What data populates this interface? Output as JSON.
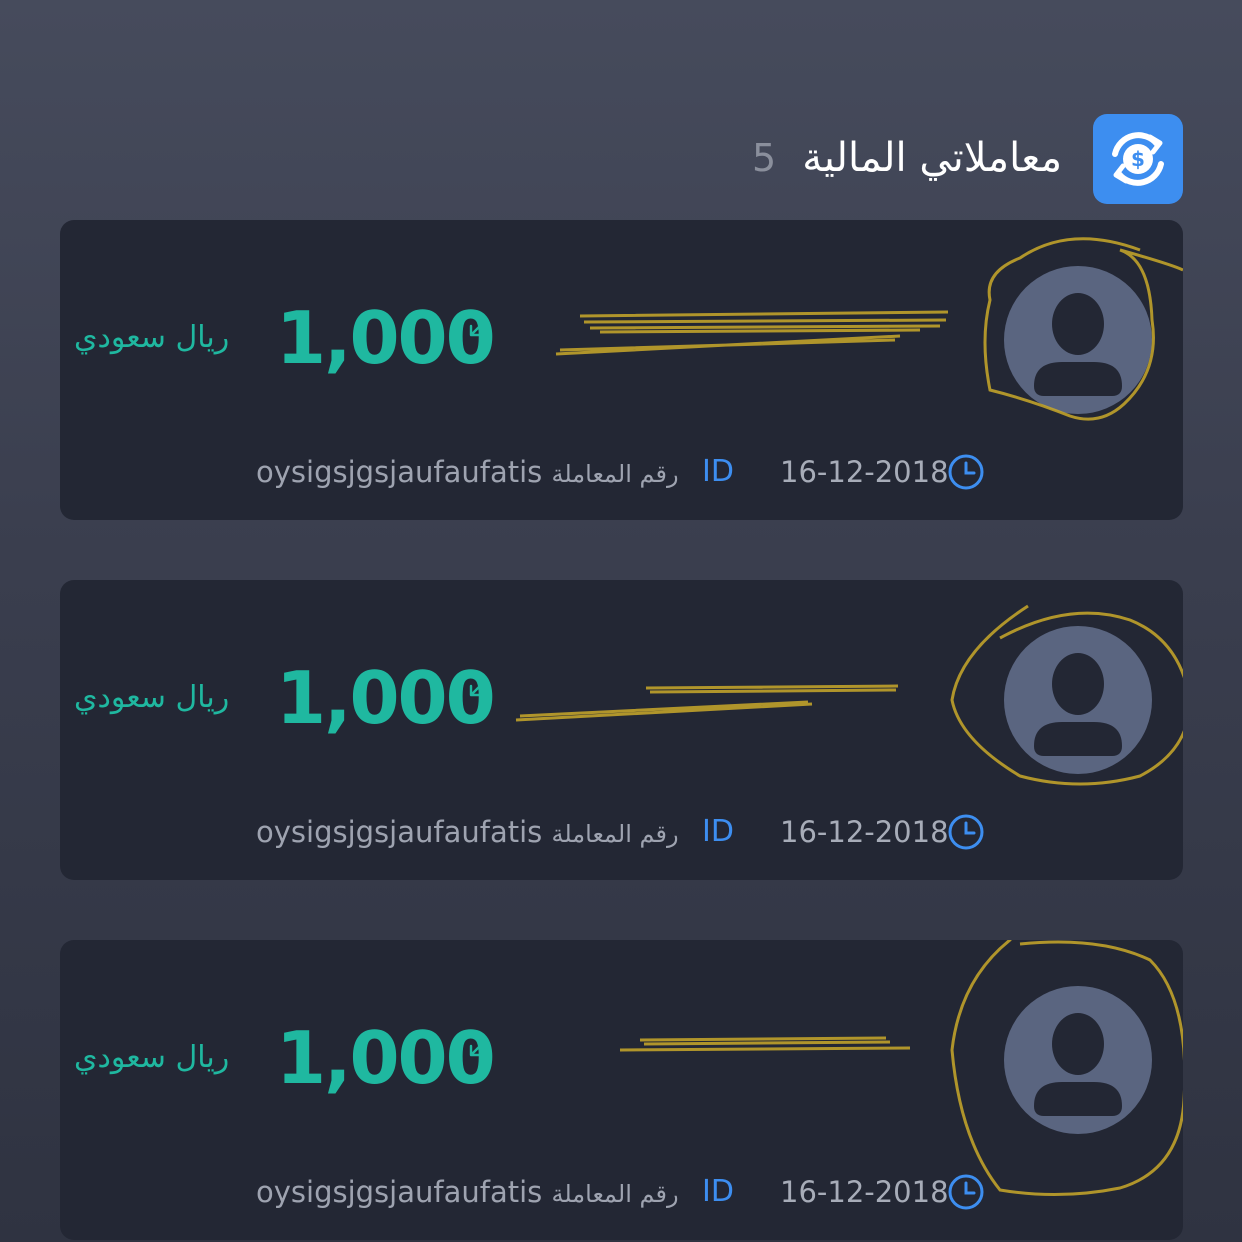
{
  "header": {
    "title": "معاملاتي المالية",
    "count": "5",
    "icon": "currency-exchange-icon",
    "accent": "#3d8ef0"
  },
  "transactions": [
    {
      "amount": "1,000",
      "currency": "ريال سعودي",
      "direction_icon": "arrow-incoming-icon",
      "avatar_icon": "user-placeholder-icon",
      "id_tag": "ID",
      "txn_id": "oysigsjgsjaufaufatis",
      "txn_label": "رقم المعاملة",
      "date": "16-12-2018",
      "clock_icon": "clock-icon"
    },
    {
      "amount": "1,000",
      "currency": "ريال سعودي",
      "direction_icon": "arrow-incoming-icon",
      "avatar_icon": "user-placeholder-icon",
      "id_tag": "ID",
      "txn_id": "oysigsjgsjaufaufatis",
      "txn_label": "رقم المعاملة",
      "date": "16-12-2018",
      "clock_icon": "clock-icon"
    },
    {
      "amount": "1,000",
      "currency": "ريال سعودي",
      "direction_icon": "arrow-incoming-icon",
      "avatar_icon": "user-placeholder-icon",
      "id_tag": "ID",
      "txn_id": "oysigsjgsjaufaufatis",
      "txn_label": "رقم المعاملة",
      "date": "16-12-2018",
      "clock_icon": "clock-icon"
    }
  ],
  "colors": {
    "amount": "#1fb8a0",
    "card": "#232734",
    "avatar": "#5a6580",
    "scribble": "#c9a92a",
    "muted": "#9ea3b0"
  }
}
